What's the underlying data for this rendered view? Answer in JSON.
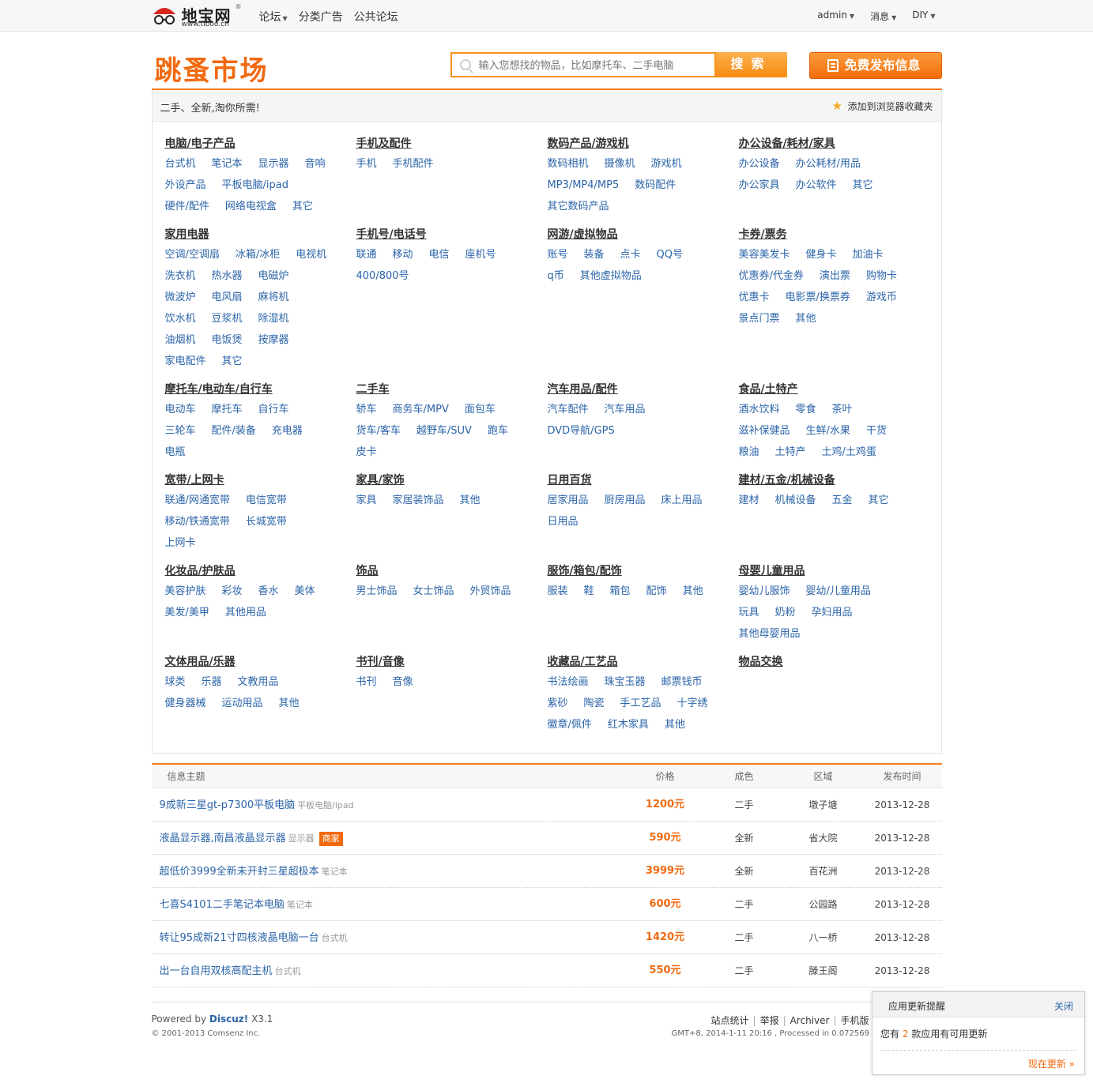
{
  "topbar": {
    "brand": "地宝网",
    "reg": "®",
    "url": "www.tiboo.cn",
    "nav": [
      "论坛",
      "分类广告",
      "公共论坛"
    ],
    "user_menu": [
      "admin",
      "消息",
      "DIY"
    ]
  },
  "header": {
    "title": "跳蚤市场",
    "search_placeholder": "输入您想找的物品，比如摩托车、二手电脑",
    "search_button": "搜索",
    "post_button": "免费发布信息",
    "slogan": "二手、全新,淘你所需!",
    "favorite": "添加到浏览器收藏夹"
  },
  "categories": [
    [
      {
        "title": "电脑/电子产品",
        "links": [
          "台式机",
          "笔记本",
          "显示器",
          "音响",
          "外设产品",
          "平板电脑/ipad",
          "硬件/配件",
          "网络电视盒",
          "其它"
        ]
      },
      {
        "title": "手机及配件",
        "links": [
          "手机",
          "手机配件"
        ]
      },
      {
        "title": "数码产品/游戏机",
        "links": [
          "数码相机",
          "摄像机",
          "游戏机",
          "MP3/MP4/MP5",
          "数码配件",
          "其它数码产品"
        ]
      },
      {
        "title": "办公设备/耗材/家具",
        "links": [
          "办公设备",
          "办公耗材/用品",
          "办公家具",
          "办公软件",
          "其它"
        ]
      }
    ],
    [
      {
        "title": "家用电器",
        "links": [
          "空调/空调扇",
          "冰箱/冰柜",
          "电视机",
          "洗衣机",
          "热水器",
          "电磁炉",
          "微波炉",
          "电风扇",
          "麻将机",
          "饮水机",
          "豆浆机",
          "除湿机",
          "油烟机",
          "电饭煲",
          "按摩器",
          "家电配件",
          "其它"
        ]
      },
      {
        "title": "手机号/电话号",
        "links": [
          "联通",
          "移动",
          "电信",
          "座机号",
          "400/800号"
        ]
      },
      {
        "title": "网游/虚拟物品",
        "links": [
          "账号",
          "装备",
          "点卡",
          "QQ号",
          "q币",
          "其他虚拟物品"
        ]
      },
      {
        "title": "卡券/票务",
        "links": [
          "美容美发卡",
          "健身卡",
          "加油卡",
          "优惠券/代金券",
          "演出票",
          "购物卡",
          "优惠卡",
          "电影票/换票券",
          "游戏币",
          "景点门票",
          "其他"
        ]
      }
    ],
    [
      {
        "title": "摩托车/电动车/自行车",
        "links": [
          "电动车",
          "摩托车",
          "自行车",
          "三轮车",
          "配件/装备",
          "充电器",
          "电瓶"
        ]
      },
      {
        "title": "二手车",
        "links": [
          "轿车",
          "商务车/MPV",
          "面包车",
          "货车/客车",
          "越野车/SUV",
          "跑车",
          "皮卡"
        ]
      },
      {
        "title": "汽车用品/配件",
        "links": [
          "汽车配件",
          "汽车用品",
          "DVD导航/GPS"
        ]
      },
      {
        "title": "食品/土特产",
        "links": [
          "酒水饮料",
          "零食",
          "茶叶",
          "滋补保健品",
          "生鲜/水果",
          "干货",
          "粮油",
          "土特产",
          "土鸡/土鸡蛋"
        ]
      }
    ],
    [
      {
        "title": "宽带/上网卡",
        "links": [
          "联通/网通宽带",
          "电信宽带",
          "移动/铁通宽带",
          "长城宽带",
          "上网卡"
        ]
      },
      {
        "title": "家具/家饰",
        "links": [
          "家具",
          "家居装饰品",
          "其他"
        ]
      },
      {
        "title": "日用百货",
        "links": [
          "居家用品",
          "厨房用品",
          "床上用品",
          "日用品"
        ]
      },
      {
        "title": "建材/五金/机械设备",
        "links": [
          "建材",
          "机械设备",
          "五金",
          "其它"
        ]
      }
    ],
    [
      {
        "title": "化妆品/护肤品",
        "links": [
          "美容护肤",
          "彩妆",
          "香水",
          "美体",
          "美发/美甲",
          "其他用品"
        ]
      },
      {
        "title": "饰品",
        "links": [
          "男士饰品",
          "女士饰品",
          "外贸饰品"
        ]
      },
      {
        "title": "服饰/箱包/配饰",
        "links": [
          "服装",
          "鞋",
          "箱包",
          "配饰",
          "其他"
        ]
      },
      {
        "title": "母婴儿童用品",
        "links": [
          "婴幼儿服饰",
          "婴幼/儿童用品",
          "玩具",
          "奶粉",
          "孕妇用品",
          "其他母婴用品"
        ]
      }
    ],
    [
      {
        "title": "文体用品/乐器",
        "links": [
          "球类",
          "乐器",
          "文教用品",
          "健身器械",
          "运动用品",
          "其他"
        ]
      },
      {
        "title": "书刊/音像",
        "links": [
          "书刊",
          "音像"
        ]
      },
      {
        "title": "收藏品/工艺品",
        "links": [
          "书法绘画",
          "珠宝玉器",
          "邮票钱币",
          "紫砂",
          "陶瓷",
          "手工艺品",
          "十字绣",
          "徽章/佩件",
          "红木家具",
          "其他"
        ]
      },
      {
        "title": "物品交换",
        "links": []
      }
    ]
  ],
  "listing": {
    "headers": {
      "subject": "信息主题",
      "price": "价格",
      "condition": "成色",
      "area": "区域",
      "date": "发布时间"
    },
    "rows": [
      {
        "title": "9成新三星gt-p7300平板电脑",
        "tag": "平板电脑/ipad",
        "merchant": "",
        "price": "1200元",
        "condition": "二手",
        "area": "墩子塘",
        "date": "2013-12-28"
      },
      {
        "title": "液晶显示器,南昌液晶显示器",
        "tag": "显示器",
        "merchant": "商家",
        "price": "590元",
        "condition": "全新",
        "area": "省大院",
        "date": "2013-12-28"
      },
      {
        "title": "超低价3999全新未开封三星超极本",
        "tag": "笔记本",
        "merchant": "",
        "price": "3999元",
        "condition": "全新",
        "area": "百花洲",
        "date": "2013-12-28"
      },
      {
        "title": "七喜S4101二手笔记本电脑",
        "tag": "笔记本",
        "merchant": "",
        "price": "600元",
        "condition": "二手",
        "area": "公园路",
        "date": "2013-12-28"
      },
      {
        "title": "转让95成新21寸四核液晶电脑一台",
        "tag": "台式机",
        "merchant": "",
        "price": "1420元",
        "condition": "二手",
        "area": "八一桥",
        "date": "2013-12-28"
      },
      {
        "title": "出一台自用双核高配主机",
        "tag": "台式机",
        "merchant": "",
        "price": "550元",
        "condition": "二手",
        "area": "滕王阁",
        "date": "2013-12-28"
      }
    ]
  },
  "footer": {
    "powered_prefix": "Powered by",
    "powered_brand": "Discuz!",
    "powered_version": "X3.1",
    "copyright": "© 2001-2013 Comsenz Inc.",
    "links": [
      "站点统计",
      "举报",
      "Archiver",
      "手机版"
    ],
    "gmt": "GMT+8, 2014-1-11 20:16 , Processed in 0.072569 sec"
  },
  "popup": {
    "title": "应用更新提醒",
    "close": "关闭",
    "msg_prefix": "您有",
    "count": "2",
    "msg_suffix": "款应用有可用更新",
    "update": "现在更新 »"
  },
  "colors": {
    "accent": "#f26a10",
    "link": "#2b64a8",
    "border_accent": "#f47b20"
  }
}
